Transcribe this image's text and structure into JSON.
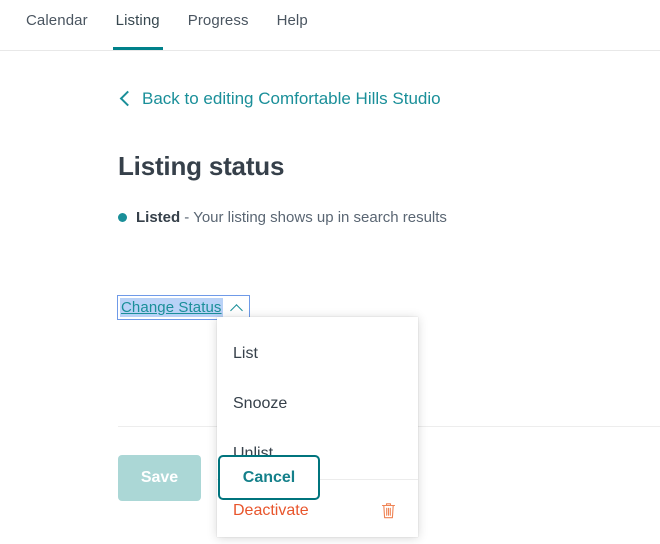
{
  "nav": {
    "tabs": [
      {
        "label": "Calendar",
        "active": false
      },
      {
        "label": "Listing",
        "active": true
      },
      {
        "label": "Progress",
        "active": false
      },
      {
        "label": "Help",
        "active": false
      }
    ]
  },
  "back_link": {
    "label": "Back to editing Comfortable Hills Studio",
    "icon": "chevron-left-icon"
  },
  "page": {
    "title": "Listing status"
  },
  "status": {
    "dot_color": "#1a8f99",
    "label": "Listed",
    "dash": "-",
    "description": "Your listing shows up in search results"
  },
  "change_status": {
    "label": "Change Status",
    "caret_icon": "chevron-up-icon",
    "focus_outline_color": "#6f9ae8",
    "selection_color": "#b9d2f7"
  },
  "dropdown": {
    "items": [
      {
        "label": "List",
        "danger": false
      },
      {
        "label": "Snooze",
        "danger": false
      },
      {
        "label": "Unlist",
        "danger": false
      },
      {
        "label": "Deactivate",
        "danger": true,
        "icon": "trash-icon"
      }
    ]
  },
  "actions": {
    "save_label": "Save",
    "save_color": "#abd7d6",
    "cancel_label": "Cancel",
    "cancel_color": "#00747d"
  }
}
